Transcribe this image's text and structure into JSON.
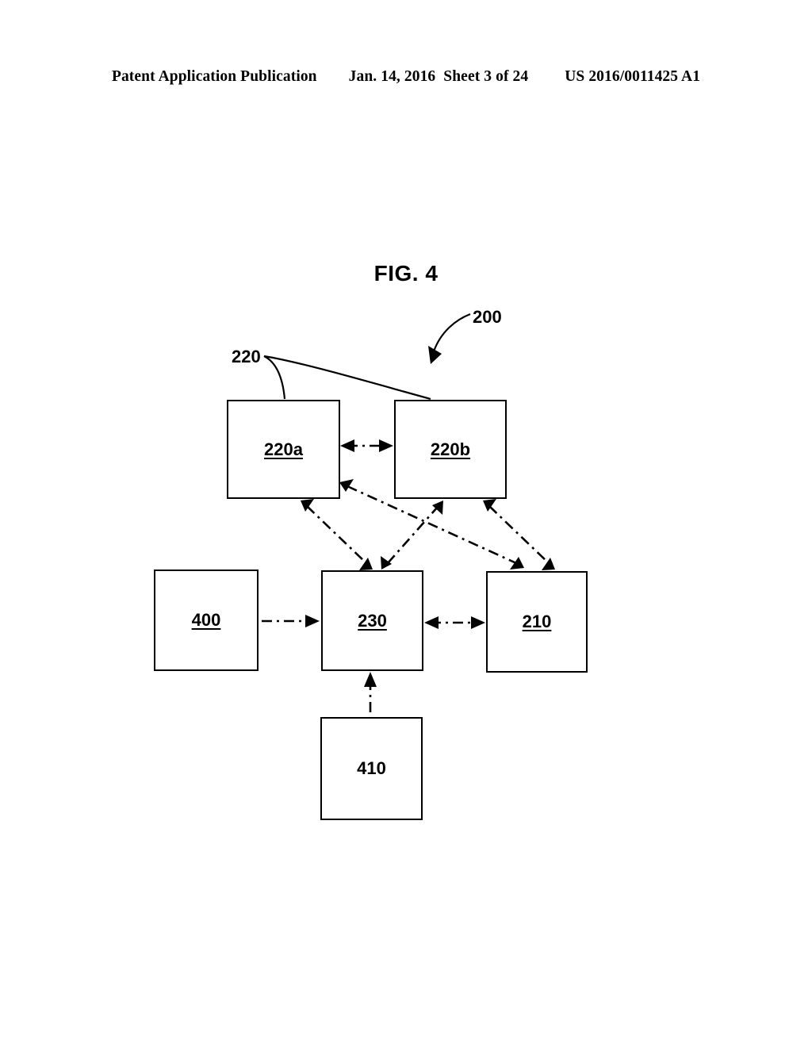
{
  "header": {
    "publication": "Patent Application Publication",
    "date": "Jan. 14, 2016",
    "sheet": "Sheet 3 of 24",
    "doc_number": "US 2016/0011425 A1"
  },
  "figure": {
    "title": "FIG. 4",
    "system_ref": "200",
    "group_ref": "220",
    "nodes": [
      {
        "id": "220a",
        "label": "220a",
        "underlined": true
      },
      {
        "id": "220b",
        "label": "220b",
        "underlined": true
      },
      {
        "id": "400",
        "label": "400",
        "underlined": true
      },
      {
        "id": "230",
        "label": "230",
        "underlined": true
      },
      {
        "id": "210",
        "label": "210",
        "underlined": true
      },
      {
        "id": "410",
        "label": "410",
        "underlined": false
      }
    ],
    "connections": [
      {
        "from": "220a",
        "to": "220b",
        "style": "dash-dot",
        "arrows": "both"
      },
      {
        "from": "220a",
        "to": "230",
        "style": "dash-dot",
        "arrows": "both"
      },
      {
        "from": "220a",
        "to": "210",
        "style": "dash-dot",
        "arrows": "both"
      },
      {
        "from": "220b",
        "to": "230",
        "style": "dash-dot",
        "arrows": "both"
      },
      {
        "from": "220b",
        "to": "210",
        "style": "dash-dot",
        "arrows": "both"
      },
      {
        "from": "400",
        "to": "230",
        "style": "dash-dot",
        "arrows": "to"
      },
      {
        "from": "230",
        "to": "210",
        "style": "dash-dot",
        "arrows": "both"
      },
      {
        "from": "410",
        "to": "230",
        "style": "dash-dot",
        "arrows": "to"
      }
    ]
  },
  "colors": {
    "ink": "#000000",
    "page": "#ffffff"
  }
}
